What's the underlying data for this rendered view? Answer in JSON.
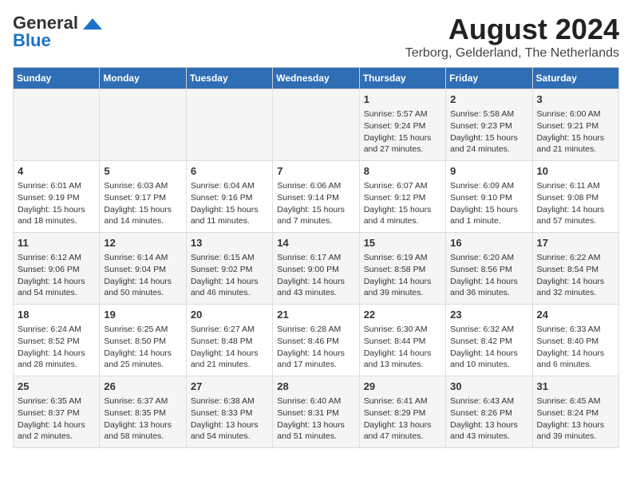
{
  "header": {
    "logo_general": "General",
    "logo_blue": "Blue",
    "main_title": "August 2024",
    "subtitle": "Terborg, Gelderland, The Netherlands"
  },
  "columns": [
    "Sunday",
    "Monday",
    "Tuesday",
    "Wednesday",
    "Thursday",
    "Friday",
    "Saturday"
  ],
  "weeks": [
    {
      "days": [
        {
          "num": "",
          "content": ""
        },
        {
          "num": "",
          "content": ""
        },
        {
          "num": "",
          "content": ""
        },
        {
          "num": "",
          "content": ""
        },
        {
          "num": "1",
          "content": "Sunrise: 5:57 AM\nSunset: 9:24 PM\nDaylight: 15 hours\nand 27 minutes."
        },
        {
          "num": "2",
          "content": "Sunrise: 5:58 AM\nSunset: 9:23 PM\nDaylight: 15 hours\nand 24 minutes."
        },
        {
          "num": "3",
          "content": "Sunrise: 6:00 AM\nSunset: 9:21 PM\nDaylight: 15 hours\nand 21 minutes."
        }
      ]
    },
    {
      "days": [
        {
          "num": "4",
          "content": "Sunrise: 6:01 AM\nSunset: 9:19 PM\nDaylight: 15 hours\nand 18 minutes."
        },
        {
          "num": "5",
          "content": "Sunrise: 6:03 AM\nSunset: 9:17 PM\nDaylight: 15 hours\nand 14 minutes."
        },
        {
          "num": "6",
          "content": "Sunrise: 6:04 AM\nSunset: 9:16 PM\nDaylight: 15 hours\nand 11 minutes."
        },
        {
          "num": "7",
          "content": "Sunrise: 6:06 AM\nSunset: 9:14 PM\nDaylight: 15 hours\nand 7 minutes."
        },
        {
          "num": "8",
          "content": "Sunrise: 6:07 AM\nSunset: 9:12 PM\nDaylight: 15 hours\nand 4 minutes."
        },
        {
          "num": "9",
          "content": "Sunrise: 6:09 AM\nSunset: 9:10 PM\nDaylight: 15 hours\nand 1 minute."
        },
        {
          "num": "10",
          "content": "Sunrise: 6:11 AM\nSunset: 9:08 PM\nDaylight: 14 hours\nand 57 minutes."
        }
      ]
    },
    {
      "days": [
        {
          "num": "11",
          "content": "Sunrise: 6:12 AM\nSunset: 9:06 PM\nDaylight: 14 hours\nand 54 minutes."
        },
        {
          "num": "12",
          "content": "Sunrise: 6:14 AM\nSunset: 9:04 PM\nDaylight: 14 hours\nand 50 minutes."
        },
        {
          "num": "13",
          "content": "Sunrise: 6:15 AM\nSunset: 9:02 PM\nDaylight: 14 hours\nand 46 minutes."
        },
        {
          "num": "14",
          "content": "Sunrise: 6:17 AM\nSunset: 9:00 PM\nDaylight: 14 hours\nand 43 minutes."
        },
        {
          "num": "15",
          "content": "Sunrise: 6:19 AM\nSunset: 8:58 PM\nDaylight: 14 hours\nand 39 minutes."
        },
        {
          "num": "16",
          "content": "Sunrise: 6:20 AM\nSunset: 8:56 PM\nDaylight: 14 hours\nand 36 minutes."
        },
        {
          "num": "17",
          "content": "Sunrise: 6:22 AM\nSunset: 8:54 PM\nDaylight: 14 hours\nand 32 minutes."
        }
      ]
    },
    {
      "days": [
        {
          "num": "18",
          "content": "Sunrise: 6:24 AM\nSunset: 8:52 PM\nDaylight: 14 hours\nand 28 minutes."
        },
        {
          "num": "19",
          "content": "Sunrise: 6:25 AM\nSunset: 8:50 PM\nDaylight: 14 hours\nand 25 minutes."
        },
        {
          "num": "20",
          "content": "Sunrise: 6:27 AM\nSunset: 8:48 PM\nDaylight: 14 hours\nand 21 minutes."
        },
        {
          "num": "21",
          "content": "Sunrise: 6:28 AM\nSunset: 8:46 PM\nDaylight: 14 hours\nand 17 minutes."
        },
        {
          "num": "22",
          "content": "Sunrise: 6:30 AM\nSunset: 8:44 PM\nDaylight: 14 hours\nand 13 minutes."
        },
        {
          "num": "23",
          "content": "Sunrise: 6:32 AM\nSunset: 8:42 PM\nDaylight: 14 hours\nand 10 minutes."
        },
        {
          "num": "24",
          "content": "Sunrise: 6:33 AM\nSunset: 8:40 PM\nDaylight: 14 hours\nand 6 minutes."
        }
      ]
    },
    {
      "days": [
        {
          "num": "25",
          "content": "Sunrise: 6:35 AM\nSunset: 8:37 PM\nDaylight: 14 hours\nand 2 minutes."
        },
        {
          "num": "26",
          "content": "Sunrise: 6:37 AM\nSunset: 8:35 PM\nDaylight: 13 hours\nand 58 minutes."
        },
        {
          "num": "27",
          "content": "Sunrise: 6:38 AM\nSunset: 8:33 PM\nDaylight: 13 hours\nand 54 minutes."
        },
        {
          "num": "28",
          "content": "Sunrise: 6:40 AM\nSunset: 8:31 PM\nDaylight: 13 hours\nand 51 minutes."
        },
        {
          "num": "29",
          "content": "Sunrise: 6:41 AM\nSunset: 8:29 PM\nDaylight: 13 hours\nand 47 minutes."
        },
        {
          "num": "30",
          "content": "Sunrise: 6:43 AM\nSunset: 8:26 PM\nDaylight: 13 hours\nand 43 minutes."
        },
        {
          "num": "31",
          "content": "Sunrise: 6:45 AM\nSunset: 8:24 PM\nDaylight: 13 hours\nand 39 minutes."
        }
      ]
    }
  ]
}
